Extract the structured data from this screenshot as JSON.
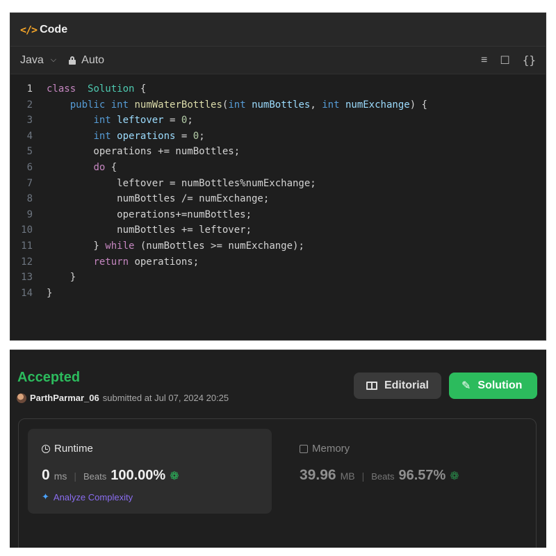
{
  "editor": {
    "title": "Code",
    "language": "Java",
    "mode": "Auto",
    "icons": [
      "format-icon",
      "bookmark-icon",
      "braces-icon"
    ],
    "lines": [
      {
        "num": "1",
        "tokens": [
          [
            "kw2",
            "class"
          ],
          [
            "",
            "  "
          ],
          [
            "cls",
            "Solution"
          ],
          [
            "",
            " {"
          ]
        ]
      },
      {
        "num": "2",
        "tokens": [
          [
            "",
            "    "
          ],
          [
            "kw",
            "public"
          ],
          [
            "",
            " "
          ],
          [
            "kw",
            "int"
          ],
          [
            "",
            " "
          ],
          [
            "fn",
            "numWaterBottles"
          ],
          [
            "",
            "("
          ],
          [
            "kw",
            "int"
          ],
          [
            "",
            " "
          ],
          [
            "var",
            "numBottles"
          ],
          [
            "",
            ", "
          ],
          [
            "kw",
            "int"
          ],
          [
            "",
            " "
          ],
          [
            "var",
            "numExchange"
          ],
          [
            "",
            ") {"
          ]
        ]
      },
      {
        "num": "3",
        "tokens": [
          [
            "",
            "        "
          ],
          [
            "kw",
            "int"
          ],
          [
            "",
            " "
          ],
          [
            "var",
            "leftover"
          ],
          [
            "",
            " = "
          ],
          [
            "num",
            "0"
          ],
          [
            "",
            ";"
          ]
        ]
      },
      {
        "num": "4",
        "tokens": [
          [
            "",
            "        "
          ],
          [
            "kw",
            "int"
          ],
          [
            "",
            " "
          ],
          [
            "var",
            "operations"
          ],
          [
            "",
            " = "
          ],
          [
            "num",
            "0"
          ],
          [
            "",
            ";"
          ]
        ]
      },
      {
        "num": "5",
        "tokens": [
          [
            "",
            "        operations += numBottles;"
          ]
        ]
      },
      {
        "num": "6",
        "tokens": [
          [
            "",
            "        "
          ],
          [
            "kw2",
            "do"
          ],
          [
            "",
            " {"
          ]
        ]
      },
      {
        "num": "7",
        "tokens": [
          [
            "",
            "            leftover = numBottles%numExchange;"
          ]
        ]
      },
      {
        "num": "8",
        "tokens": [
          [
            "",
            "            numBottles /= numExchange;"
          ]
        ]
      },
      {
        "num": "9",
        "tokens": [
          [
            "",
            "            operations+=numBottles;"
          ]
        ]
      },
      {
        "num": "10",
        "tokens": [
          [
            "",
            "            numBottles += leftover;"
          ]
        ]
      },
      {
        "num": "11",
        "tokens": [
          [
            "",
            "        } "
          ],
          [
            "kw2",
            "while"
          ],
          [
            "",
            " (numBottles >= numExchange);"
          ]
        ]
      },
      {
        "num": "12",
        "tokens": [
          [
            "",
            "        "
          ],
          [
            "kw2",
            "return"
          ],
          [
            "",
            " operations;"
          ]
        ]
      },
      {
        "num": "13",
        "tokens": [
          [
            "",
            "    }"
          ]
        ]
      },
      {
        "num": "14",
        "tokens": [
          [
            "",
            "}"
          ]
        ]
      }
    ]
  },
  "result": {
    "status": "Accepted",
    "username": "ParthParmar_06",
    "submitted_text": "submitted at Jul 07, 2024 20:25",
    "editorial_label": "Editorial",
    "solution_label": "Solution",
    "runtime": {
      "title": "Runtime",
      "value": "0",
      "unit": "ms",
      "beats_label": "Beats",
      "beats_value": "100.00%"
    },
    "memory": {
      "title": "Memory",
      "value": "39.96",
      "unit": "MB",
      "beats_label": "Beats",
      "beats_value": "96.57%"
    },
    "analyze_label": "Analyze Complexity"
  },
  "colors": {
    "accent_green": "#2cbb5d",
    "code_icon_orange": "#f7a628",
    "analyze_purple": "#8a6df0"
  }
}
